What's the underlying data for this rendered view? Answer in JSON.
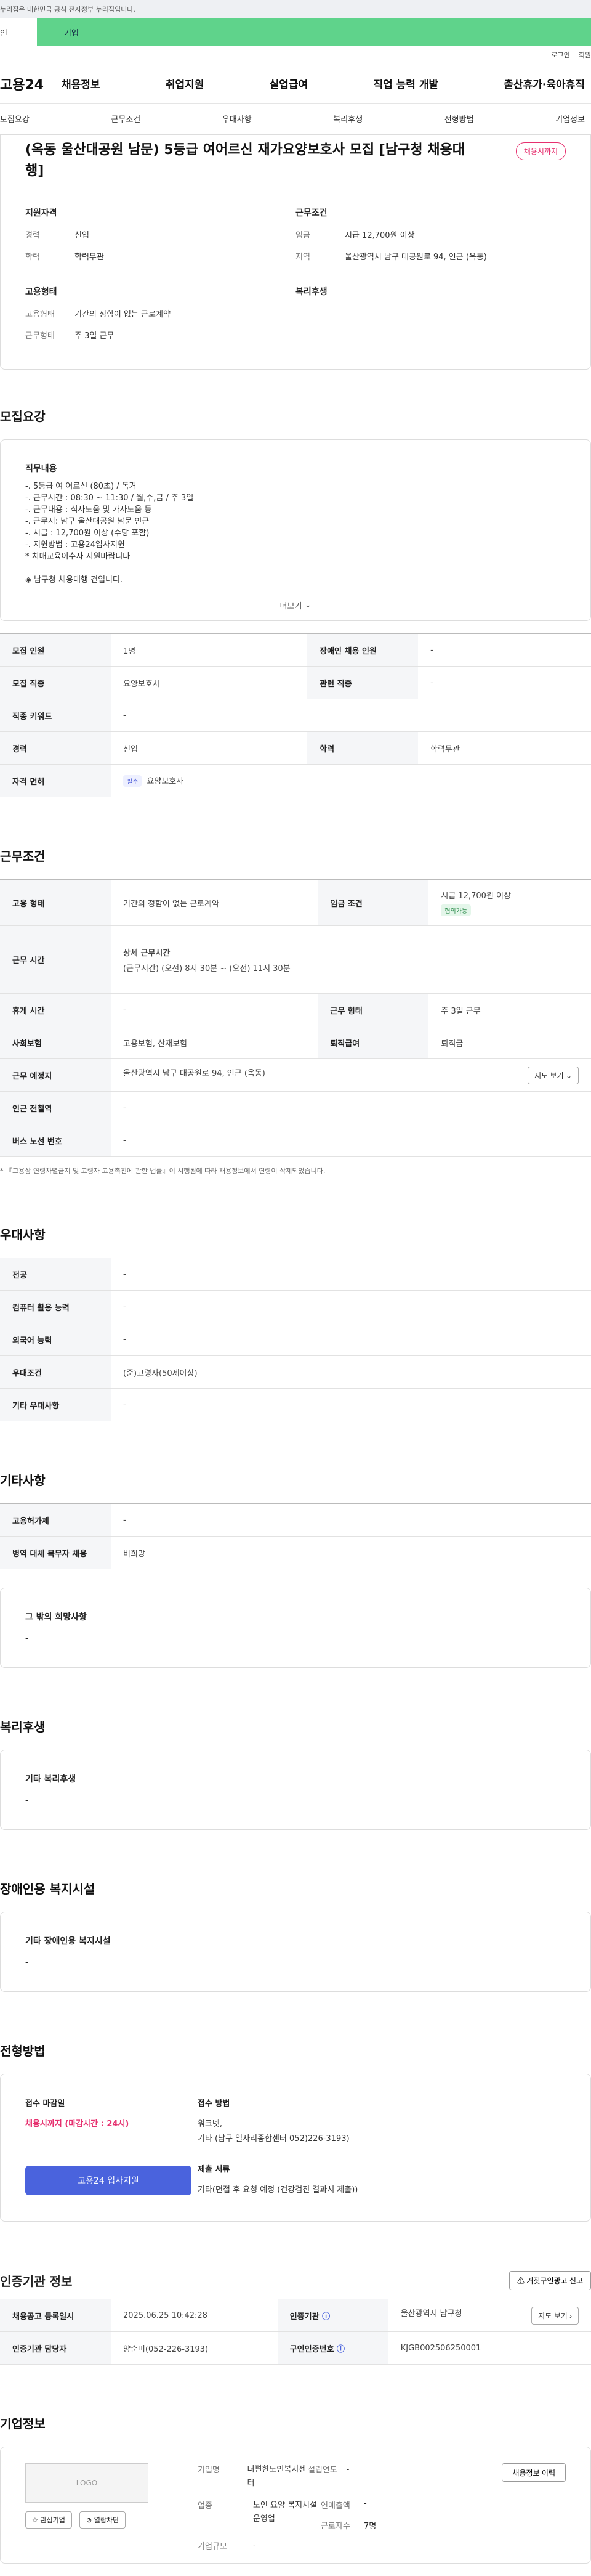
{
  "gov_notice": "누리집은 대한민국 공식 전자정부 누리집입니다.",
  "portal_tabs": {
    "person": "인",
    "business": "기업"
  },
  "util": {
    "login": "로그인",
    "join": "회원"
  },
  "gnb": {
    "logo": "고용24",
    "menu": [
      "채용정보",
      "취업지원",
      "실업급여",
      "직업 능력 개발",
      "출산휴가·육아휴직"
    ]
  },
  "subtabs": [
    "모집요강",
    "근무조건",
    "우대사항",
    "복리후생",
    "전형방법",
    "기업정보"
  ],
  "summary": {
    "title": "(옥동 울산대공원 남문) 5등급 여어르신 재가요양보호사 모집 [남구청 채용대행]",
    "deadline_badge": "채용시까지",
    "qualification_heading": "지원자격",
    "conditions_heading": "근무조건",
    "employment_heading": "고용형태",
    "welfare_heading": "복리후생",
    "career_k": "경력",
    "career_v": "신입",
    "edu_k": "학력",
    "edu_v": "학력무관",
    "wage_k": "임금",
    "wage_v": "시급 12,700원 이상",
    "region_k": "지역",
    "region_v": "울산광역시 남구 대공원로 94, 인근 (옥동)",
    "emp_type_k": "고용형태",
    "emp_type_v": "기간의 정함이 없는 근로계약",
    "work_form_k": "근무형태",
    "work_form_v": "주 3일 근무"
  },
  "recruit": {
    "title": "모집요강",
    "job_desc_heading": "직무내용",
    "job_desc_lines": [
      "-. 5등급 여 어르신 (80초) / 독거",
      "-. 근무시간 : 08:30 ~ 11:30 / 월,수,금 / 주 3일",
      "-. 근무내용 : 식사도움 및 가사도움 등",
      "-. 근무지: 남구 울산대공원 남문 인근",
      "-. 시급 : 12,700원 이상 (수당 포함)",
      "-. 지원방법 : 고용24입사지원",
      "* 치매교육이수자 지원바랍니다",
      "",
      "◈ 남구청 채용대행 건입니다."
    ],
    "more": "더보기",
    "rows": [
      {
        "k1": "모집 인원",
        "v1": "1명",
        "k2": "장애인 채용 인원",
        "v2": "-"
      },
      {
        "k1": "모집 직종",
        "v1": "요양보호사",
        "k2": "관련 직종",
        "v2": "-"
      },
      {
        "k1": "직종 키워드",
        "v1": "-"
      },
      {
        "k1": "경력",
        "v1": "신입",
        "k2": "학력",
        "v2": "학력무관"
      }
    ],
    "license_k": "자격 면허",
    "license_pill": "필수",
    "license_v": "요양보호사"
  },
  "work": {
    "title": "근무조건",
    "emp_type_k": "고용 형태",
    "emp_type_v": "기간의 정함이 없는 근로계약",
    "wage_k": "임금 조건",
    "wage_v": "시급 12,700원 이상",
    "wage_pill": "협의가능",
    "hours_k": "근무 시간",
    "hours_sub": "상세 근무시간",
    "hours_v": "(근무시간) (오전) 8시 30분 ~ (오전) 11시 30분",
    "holiday_k": "휴게 시간",
    "holiday_v": "-",
    "form_k": "근무 형태",
    "form_v": "주 3일 근무",
    "insurance_k": "사회보험",
    "insurance_v": "고용보험, 산재보험",
    "severance_k": "퇴직급여",
    "severance_v": "퇴직금",
    "place_k": "근무 예정지",
    "place_v": "울산광역시 남구 대공원로 94, 인근 (옥동)",
    "map_btn": "지도 보기",
    "subway_k": "인근 전철역",
    "subway_v": "-",
    "bus_k": "버스 노선 번호",
    "bus_v": "-",
    "note": "* 『고용상 연령차별금지 및 고령자 고용촉진에 관한 법률』이 시행됨에 따라 채용정보에서 연령이 삭제되었습니다."
  },
  "prefer": {
    "title": "우대사항",
    "rows": [
      {
        "k": "전공",
        "v": "-"
      },
      {
        "k": "컴퓨터 활용 능력",
        "v": "-"
      },
      {
        "k": "외국어 능력",
        "v": "-"
      },
      {
        "k": "우대조건",
        "v": "(준)고령자(50세이상)"
      },
      {
        "k": "기타 우대사항",
        "v": "-"
      }
    ]
  },
  "etc": {
    "title": "기타사항",
    "rows": [
      {
        "k": "고용허가제",
        "v": "-"
      },
      {
        "k": "병역 대체 복무자 채용",
        "v": "비희망"
      }
    ],
    "other_heading": "그 밖의 희망사항",
    "other_v": "-"
  },
  "welfare": {
    "title": "복리후생",
    "heading": "기타 복리후생",
    "v": "-"
  },
  "disabled": {
    "title": "장애인용 복지시설",
    "heading": "기타 장애인용 복지시설",
    "v": "-"
  },
  "apply": {
    "title": "전형방법",
    "deadline_heading": "접수 마감일",
    "deadline_v": "채용시까지 (마감시간 : 24시)",
    "apply_btn": "고용24 입사지원",
    "method_heading": "접수 방법",
    "method_line1": "워크넷,",
    "method_line2": "기타 (남구 일자리종합센터 052)226-3193)",
    "docs_heading": "제출 서류",
    "docs_v": "기타(면접 후 요청 예정 (건강검진 결과서 제출))"
  },
  "agency": {
    "title": "인증기관 정보",
    "report_btn": "거짓구인광고 신고",
    "reg_date_k": "채용공고 등록일시",
    "reg_date_v": "2025.06.25 10:42:28",
    "agency_k": "인증기관",
    "agency_v": "울산광역시 남구청",
    "detail_btn": "지도 보기",
    "manager_k": "인증기관 담당자",
    "manager_v": "양순미(052-226-3193)",
    "auth_k": "구인인증번호",
    "auth_v": "KJGB002506250001"
  },
  "company": {
    "title": "기업정보",
    "logo": "LOGO",
    "fav_btn": "관심기업",
    "block_btn": "열람차단",
    "name_k": "기업명",
    "name_v": "더편한노인복지센터",
    "est_k": "설립연도",
    "est_v": "-",
    "industry_k": "업종",
    "industry_v": "노인 요양 복지시설 운영업",
    "sales_k": "연매출액",
    "sales_v": "-",
    "emp_k": "근로자수",
    "emp_v": "7명",
    "size_k": "기업규모",
    "size_v": "-",
    "info_btn": "채용정보 이력"
  }
}
